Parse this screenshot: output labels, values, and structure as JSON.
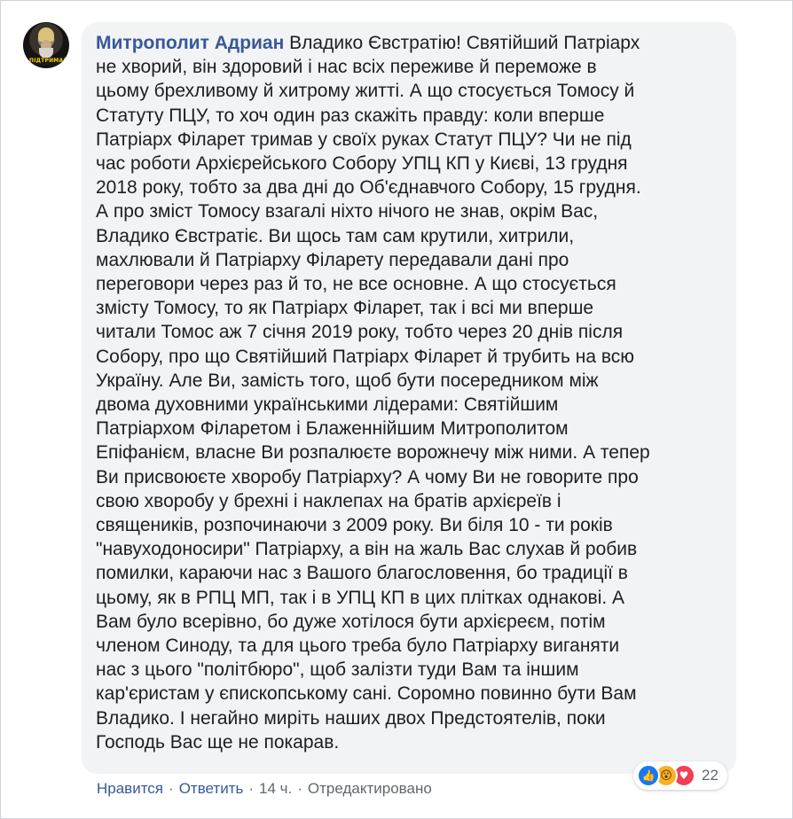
{
  "comment": {
    "author": "Митрополит Адриан",
    "avatar_label": "ПІДТРИМАЙ",
    "text": "Владико Євстратію! Святійший Патріарх\nне хворий, він здоровий і нас всіх переживе й переможе в\nцьому брехливому й хитрому житті. А що стосується Томосу й\nСтатуту ПЦУ, то хоч один раз скажіть правду: коли вперше\nПатріарх Філарет тримав у своїх руках Статут ПЦУ? Чи не під\nчас роботи Архієрейського Собору УПЦ КП у Києві, 13 грудня\n2018 року, тобто за два дні до Об'єднавчого Собору, 15 грудня.\nА про зміст Томосу взагалі ніхто нічого не знав, окрім Вас,\nВладико Євстратіє. Ви щось там сам крутили, хитрили,\nмахлювали й Патріарху Філарету передавали дані про\nпереговори через раз й то, не все основне. А що стосується\nзмісту Томосу, то як Патріарх Філарет, так і всі ми вперше\nчитали Томос аж 7 січня 2019 року, тобто через 20 днів після\nСобору, про що Святійший Патріарх Філарет й трубить на всю\nУкраїну. Але Ви, замість того, щоб бути посередником між\nдвома духовними українськими лідерами: Святійшим\nПатріархом Філаретом і Блаженнійшим Митрополитом\nЕпіфанієм, власне Ви розпалюєте ворожнечу між ними. А тепер\nВи присвоюєте хворобу Патріарху? А чому Ви не говорите про\nсвою хворобу у брехні і наклепах на братів архієреїв і\nсвящеників, розпочинаючи з 2009 року. Ви біля 10 - ти років\n\"навуходоносири\" Патріарху, а він на жаль Вас слухав й робив\nпомилки, караючи нас з Вашого благословення, бо традиції в\nцьому, як в РПЦ МП, так і в УПЦ КП в цих плітках однакові. А\nВам було всерівно, бо дуже хотілося бути архієреєм, потім\nчленом Синоду, та для цього треба було Патріарху виганяти\nнас з цього \"політбюро\", щоб залізти туди Вам та іншим\nкар'єристам у єпископському сані. Соромно повинно бути Вам\nВладико. І негайно миріть наших двох Предстоятелів, поки\nГосподь Вас ще не покарав."
  },
  "reactions": {
    "icons": [
      "like-icon",
      "wow-icon",
      "love-icon"
    ],
    "like_glyph": "👍",
    "wow_glyph": "😮",
    "love_glyph": "♥",
    "count": "22"
  },
  "actions": {
    "like": "Нравится",
    "reply": "Ответить",
    "time": "14 ч.",
    "edited": "Отредактировано",
    "separator": "·"
  },
  "colors": {
    "author_link": "#385898",
    "bubble_bg": "#f2f3f5",
    "text": "#1c1e21",
    "meta": "#606770",
    "like_blue": "#1877f2",
    "wow_yellow": "#f7b125",
    "love_red": "#f33e58"
  }
}
